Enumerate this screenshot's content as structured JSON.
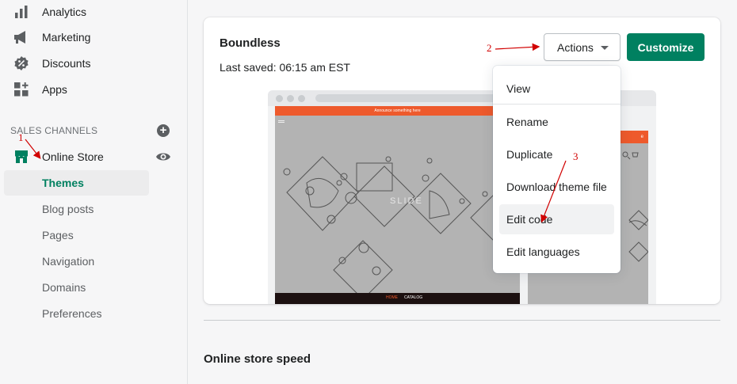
{
  "sidebar": {
    "items": [
      {
        "label": "Analytics",
        "icon": "bar-chart-icon"
      },
      {
        "label": "Marketing",
        "icon": "megaphone-icon"
      },
      {
        "label": "Discounts",
        "icon": "discount-tag-icon"
      },
      {
        "label": "Apps",
        "icon": "apps-grid-icon"
      }
    ],
    "sales_channels_label": "SALES CHANNELS",
    "online_store_label": "Online Store",
    "sub_items": [
      "Themes",
      "Blog posts",
      "Pages",
      "Navigation",
      "Domains",
      "Preferences"
    ],
    "active_sub_item": "Themes"
  },
  "theme": {
    "name": "Boundless",
    "last_saved": "Last saved: 06:15 am EST",
    "actions_label": "Actions",
    "customize_label": "Customize",
    "preview": {
      "announcement": "Announce something here",
      "slide_text": "SLIDE",
      "footer_home": "HOME",
      "footer_catalog": "CATALOG",
      "mobile_header_text": "e"
    }
  },
  "actions_menu": {
    "items": [
      "View",
      "Rename",
      "Duplicate",
      "Download theme file",
      "Edit code",
      "Edit languages"
    ],
    "highlighted": "Edit code"
  },
  "speed_section_title": "Online store speed",
  "annotations": [
    "1",
    "2",
    "3"
  ],
  "colors": {
    "brand_green": "#008060",
    "annotation_red": "#d10000",
    "preview_orange": "#ee5a2c"
  }
}
